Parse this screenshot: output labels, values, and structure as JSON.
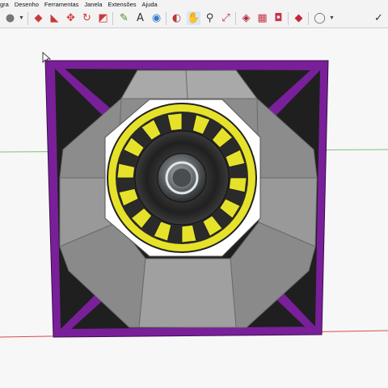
{
  "menu": {
    "items": [
      "gra",
      "Desenho",
      "Ferramentas",
      "Janela",
      "Extensões",
      "Ajuda"
    ]
  },
  "toolbar": {
    "tools": [
      {
        "icon": "material-swatch-icon",
        "glyph": "●",
        "color": "#777777"
      },
      {
        "icon": "push-pull-icon",
        "glyph": "◆",
        "color": "#c83a3a"
      },
      {
        "icon": "follow-me-icon",
        "glyph": "◣",
        "color": "#c83a3a"
      },
      {
        "icon": "move-icon",
        "glyph": "✥",
        "color": "#d23a3a"
      },
      {
        "icon": "rotate-icon",
        "glyph": "↻",
        "color": "#d23a3a"
      },
      {
        "icon": "scale-icon",
        "glyph": "◩",
        "color": "#c83a3a"
      },
      {
        "icon": "tape-measure-icon",
        "glyph": "✎",
        "color": "#4f8a20"
      },
      {
        "icon": "text-tool-icon",
        "glyph": "A",
        "color": "#333333"
      },
      {
        "icon": "paint-bucket-icon",
        "glyph": "◉",
        "color": "#3a7ac8"
      },
      {
        "icon": "orbit-icon",
        "glyph": "◐",
        "color": "#b43a3a"
      },
      {
        "icon": "pan-icon",
        "glyph": "✋",
        "color": "#3a6fb4"
      },
      {
        "icon": "zoom-icon",
        "glyph": "⚲",
        "color": "#333333"
      },
      {
        "icon": "zoom-extents-icon",
        "glyph": "⤢",
        "color": "#b43a3a"
      },
      {
        "icon": "warehouse-icon",
        "glyph": "◈",
        "color": "#b4233a"
      },
      {
        "icon": "extension-warehouse-icon",
        "glyph": "▦",
        "color": "#c8344a"
      },
      {
        "icon": "share-model-icon",
        "glyph": "◘",
        "color": "#c8344a"
      },
      {
        "icon": "ruby-icon",
        "glyph": "◆",
        "color": "#c8233a"
      },
      {
        "icon": "account-icon",
        "glyph": "◯",
        "color": "#666666"
      },
      {
        "icon": "checkmark-icon",
        "glyph": "✓",
        "color": "#333333"
      }
    ]
  },
  "colors": {
    "frame": "#7a1f9a",
    "panel": "#8a8a8a",
    "panel_light": "#a9a9a9",
    "corner": "#1f1f1f",
    "speaker_ring": "#e6e22a",
    "ground_red": "#d94a4a",
    "ground_green": "#7cc27c"
  }
}
